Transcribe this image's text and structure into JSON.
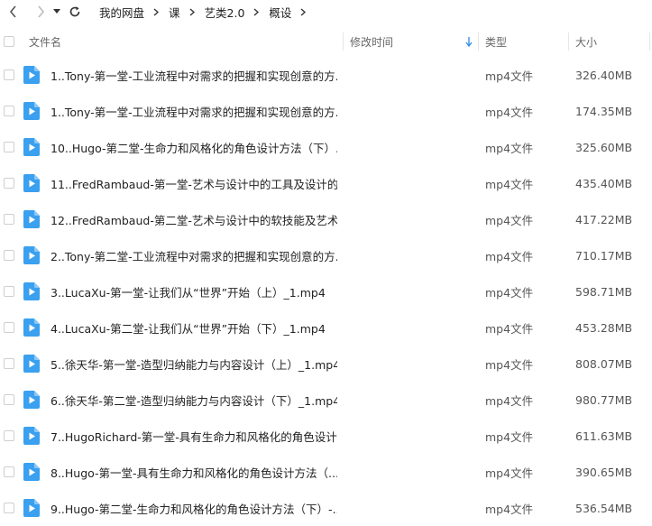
{
  "breadcrumbs": [
    "我的网盘",
    "课",
    "艺类2.0",
    "概设"
  ],
  "columns": {
    "name": "文件名",
    "modified": "修改时间",
    "type": "类型",
    "size": "大小"
  },
  "files": [
    {
      "name": "1..Tony-第一堂-工业流程中对需求的把握和实现创意的方...",
      "type": "mp4文件",
      "size": "326.40MB"
    },
    {
      "name": "1..Tony-第一堂-工业流程中对需求的把握和实现创意的方...",
      "type": "mp4文件",
      "size": "174.35MB"
    },
    {
      "name": "10..Hugo-第二堂-生命力和风格化的角色设计方法（下）...",
      "type": "mp4文件",
      "size": "325.60MB"
    },
    {
      "name": "11..FredRambaud-第一堂-艺术与设计中的工具及设计的...",
      "type": "mp4文件",
      "size": "435.40MB"
    },
    {
      "name": "12..FredRambaud-第二堂-艺术与设计中的软技能及艺术...",
      "type": "mp4文件",
      "size": "417.22MB"
    },
    {
      "name": "2..Tony-第二堂-工业流程中对需求的把握和实现创意的方...",
      "type": "mp4文件",
      "size": "710.17MB"
    },
    {
      "name": "3..LucaXu-第一堂-让我们从“世界”开始（上）_1.mp4",
      "type": "mp4文件",
      "size": "598.71MB"
    },
    {
      "name": "4..LucaXu-第二堂-让我们从“世界”开始（下）_1.mp4",
      "type": "mp4文件",
      "size": "453.28MB"
    },
    {
      "name": "5..徐天华-第一堂-造型归纳能力与内容设计（上）_1.mp4",
      "type": "mp4文件",
      "size": "808.07MB"
    },
    {
      "name": "6..徐天华-第二堂-造型归纳能力与内容设计（下）_1.mp4",
      "type": "mp4文件",
      "size": "980.77MB"
    },
    {
      "name": "7..HugoRichard-第一堂-具有生命力和风格化的角色设计...",
      "type": "mp4文件",
      "size": "611.63MB"
    },
    {
      "name": "8..Hugo-第一堂-具有生命力和风格化的角色设计方法（...",
      "type": "mp4文件",
      "size": "390.65MB"
    },
    {
      "name": "9..Hugo-第二堂-生命力和风格化的角色设计方法（下）-...",
      "type": "mp4文件",
      "size": "536.54MB"
    }
  ],
  "colors": {
    "icon": "#3aa0ef",
    "header_text": "#666666",
    "sort_arrow": "#3a8ee6"
  },
  "icons": {
    "back": "chevron-left-icon",
    "forward": "chevron-right-icon",
    "history": "caret-down-icon",
    "refresh": "refresh-icon",
    "sort": "sort-desc-arrow-icon",
    "file": "video-file-icon"
  }
}
